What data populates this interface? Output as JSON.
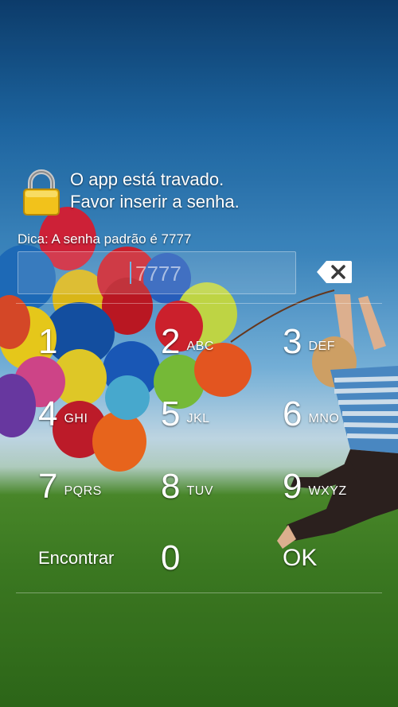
{
  "lock_message": {
    "line1": "O app está travado.",
    "line2": "Favor inserir a senha."
  },
  "hint": "Dica: A senha padrão é 7777",
  "pin_input": {
    "value": "",
    "placeholder": "7777"
  },
  "keypad": {
    "keys": [
      {
        "num": "1",
        "letters": ""
      },
      {
        "num": "2",
        "letters": "ABC"
      },
      {
        "num": "3",
        "letters": "DEF"
      },
      {
        "num": "4",
        "letters": "GHI"
      },
      {
        "num": "5",
        "letters": "JKL"
      },
      {
        "num": "6",
        "letters": "MNO"
      },
      {
        "num": "7",
        "letters": "PQRS"
      },
      {
        "num": "8",
        "letters": "TUV"
      },
      {
        "num": "9",
        "letters": "WXYZ"
      }
    ],
    "find_label": "Encontrar",
    "zero": "0",
    "ok_label": "OK"
  },
  "icons": {
    "lock": "padlock-icon",
    "backspace": "backspace-icon"
  },
  "colors": {
    "caret": "#6fb4e6",
    "lock_gold": "#f2c21b"
  }
}
